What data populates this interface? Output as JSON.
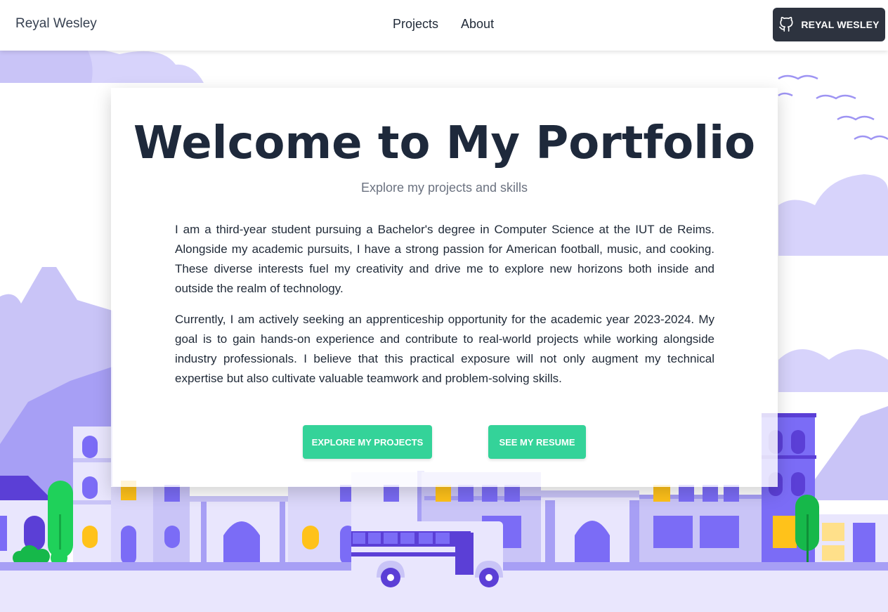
{
  "header": {
    "brand": "Reyal Wesley",
    "nav": [
      "Projects",
      "About"
    ],
    "github_button": {
      "label": "REYAL WESLEY",
      "icon": "github-icon"
    }
  },
  "hero": {
    "title": "Welcome to My Portfolio",
    "subtitle": "Explore my projects and skills",
    "paragraphs": [
      "I am a third-year student pursuing a Bachelor's degree in Computer Science at the IUT de Reims. Alongside my academic pursuits, I have a strong passion for American football, music, and cooking. These diverse interests fuel my creativity and drive me to explore new horizons both inside and outside the realm of technology.",
      "Currently, I am actively seeking an apprenticeship opportunity for the academic year 2023-2024. My goal is to gain hands-on experience and contribute to real-world projects while working alongside industry professionals. I believe that this practical exposure will not only augment my technical expertise but also cultivate valuable teamwork and problem-solving skills."
    ],
    "buttons": [
      "EXPLORE MY PROJECTS",
      "SEE MY RESUME"
    ]
  },
  "colors": {
    "accent": "#34d399",
    "dark_button": "#2d333f",
    "illustration_purple": "#7b6cf6",
    "illustration_light": "#c9c4f7"
  }
}
